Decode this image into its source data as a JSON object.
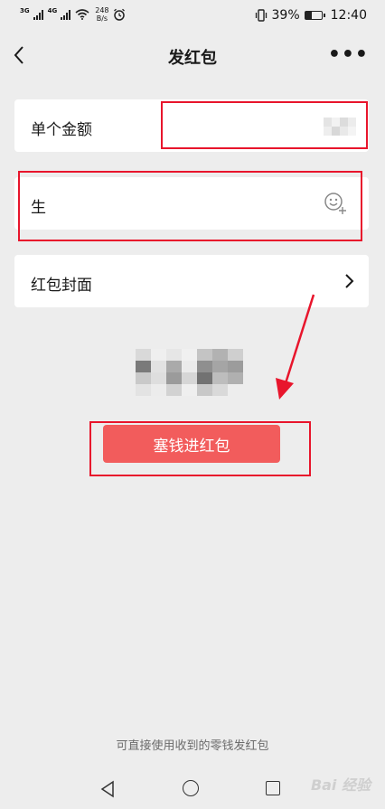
{
  "status_bar": {
    "net_left": "3G",
    "net_right": "4G",
    "speed_value": "248",
    "speed_unit": "B/s",
    "battery_percent": "39%",
    "battery_level": 0.39,
    "time": "12:40",
    "icons": [
      "signal-icon",
      "wifi-icon",
      "alarm-icon",
      "vibrate-icon",
      "battery-icon"
    ]
  },
  "nav": {
    "title": "发红包",
    "more": "•••"
  },
  "form": {
    "amount_label": "单个金额",
    "greeting_value": "生",
    "cover_label": "红包封面"
  },
  "button": {
    "send_label": "塞钱进红包"
  },
  "footer": {
    "hint": "可直接使用收到的零钱发红包"
  },
  "watermark": "Bai 经验",
  "colors": {
    "accent": "#f25c5c",
    "annotation": "#e8152c",
    "background": "#ededed"
  }
}
